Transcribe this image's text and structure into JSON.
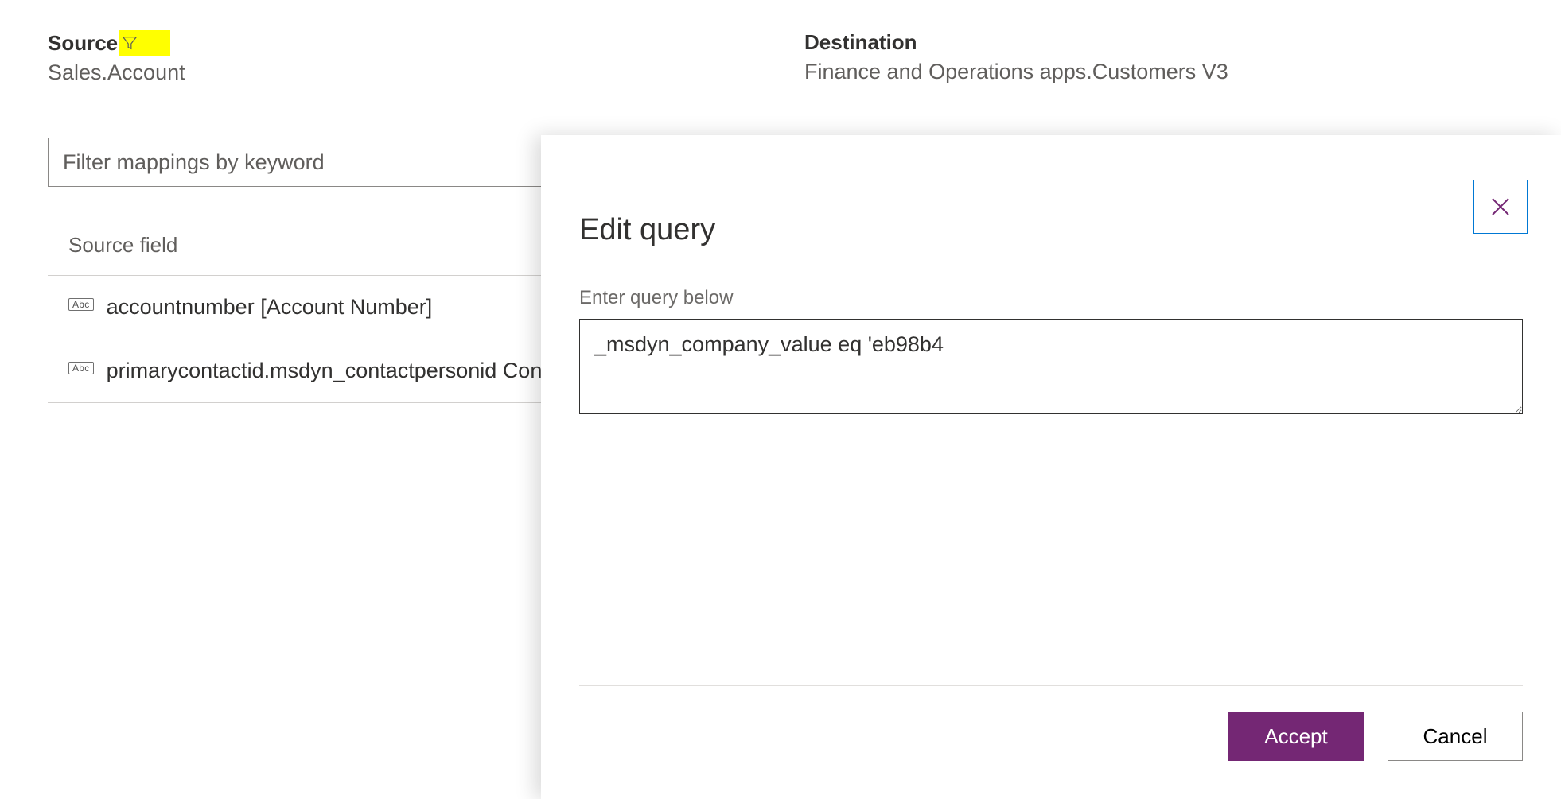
{
  "header": {
    "source_label": "Source",
    "source_value": "Sales.Account",
    "destination_label": "Destination",
    "destination_value": "Finance and Operations apps.Customers V3"
  },
  "filter_input": {
    "placeholder": "Filter mappings by keyword",
    "value": ""
  },
  "source_field_header": "Source field",
  "fields": [
    {
      "type_badge": "Abc",
      "text": "accountnumber [Account Number]"
    },
    {
      "type_badge": "Abc",
      "text": "primarycontactid.msdyn_contactpersonid Contact (Account Number/Contact Person ID)"
    }
  ],
  "dialog": {
    "title": "Edit query",
    "label": "Enter query below",
    "query_value": "_msdyn_company_value eq 'eb98b4",
    "accept_label": "Accept",
    "cancel_label": "Cancel"
  }
}
